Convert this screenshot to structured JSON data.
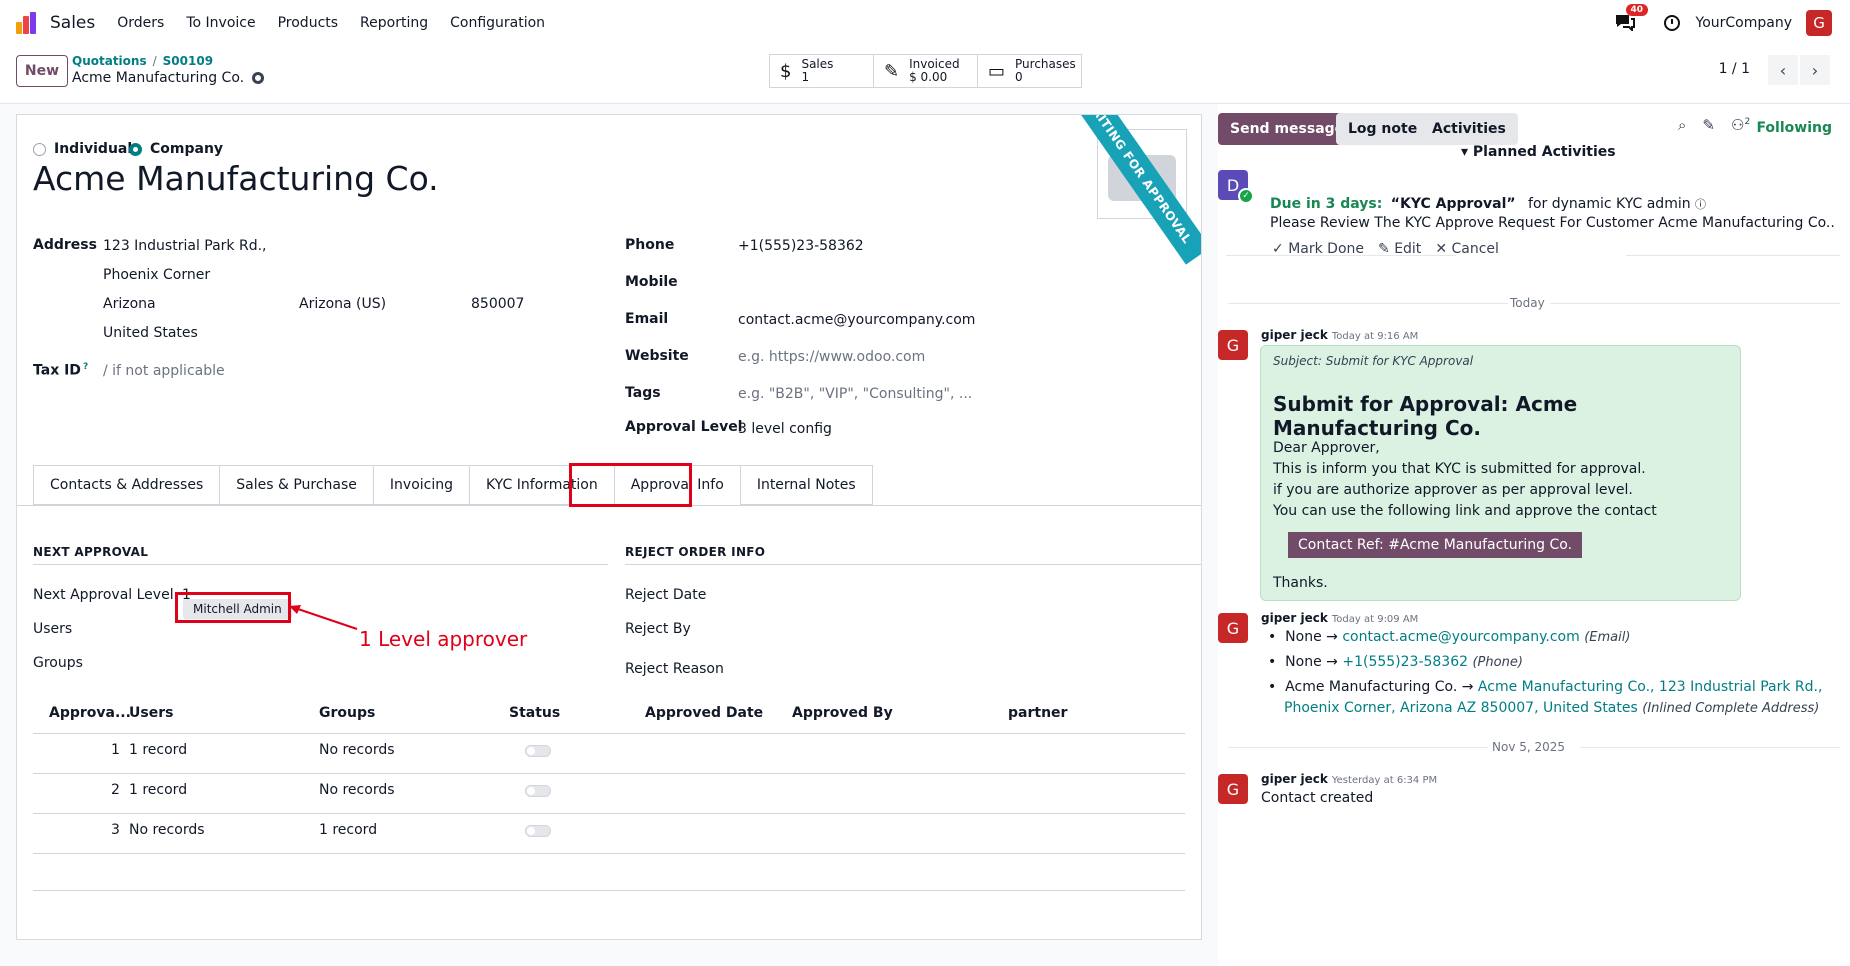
{
  "nav": {
    "app": "Sales",
    "menus": [
      "Orders",
      "To Invoice",
      "Products",
      "Reporting",
      "Configuration"
    ],
    "chat_badge": "40",
    "company": "YourCompany",
    "user_initial": "G"
  },
  "control": {
    "new": "New",
    "crumb1": "Quotations",
    "crumb2": "S00109",
    "record": "Acme Manufacturing Co.",
    "smart": [
      {
        "label": "Sales",
        "value": "1",
        "icon": "dollar-icon"
      },
      {
        "label": "Invoiced",
        "value": "$ 0.00",
        "icon": "edit-icon"
      },
      {
        "label": "Purchases",
        "value": "0",
        "icon": "card-icon"
      }
    ],
    "pager": "1 / 1"
  },
  "form": {
    "ribbon": "WAITING FOR APPROVAL",
    "radio_individual": "Individual",
    "radio_company": "Company",
    "name": "Acme Manufacturing Co.",
    "address_label": "Address",
    "street": "123 Industrial Park Rd.,",
    "street2": "Phoenix Corner",
    "city": "Arizona",
    "state": "Arizona (US)",
    "zip": "850007",
    "country": "United States",
    "taxid_label": "Tax ID",
    "taxid_sup": "?",
    "taxid_ph": "/ if not applicable",
    "phone_label": "Phone",
    "phone": "+1(555)23-58362",
    "mobile_label": "Mobile",
    "email_label": "Email",
    "email": "contact.acme@yourcompany.com",
    "website_label": "Website",
    "website_ph": "e.g. https://www.odoo.com",
    "tags_label": "Tags",
    "tags_ph": "e.g. \"B2B\", \"VIP\", \"Consulting\", ...",
    "approval_label": "Approval Level",
    "approval": "3 level config"
  },
  "tabs": [
    "Contacts & Addresses",
    "Sales & Purchase",
    "Invoicing",
    "KYC Information",
    "Approval Info",
    "Internal Notes"
  ],
  "approval": {
    "next_head": "NEXT APPROVAL",
    "reject_head": "REJECT ORDER INFO",
    "next_level_label": "Next Approval Level",
    "next_level": "1",
    "users_label": "Users",
    "user_tag": "Mitchell Admin",
    "groups_label": "Groups",
    "reject_date": "Reject Date",
    "reject_by": "Reject By",
    "reject_reason": "Reject Reason",
    "annotation": "1 Level approver"
  },
  "table": {
    "headers": [
      "Approva...",
      "Users",
      "Groups",
      "Status",
      "Approved Date",
      "Approved By",
      "partner"
    ],
    "rows": [
      {
        "level": "1",
        "users": "1 record",
        "groups": "No records"
      },
      {
        "level": "2",
        "users": "1 record",
        "groups": "No records"
      },
      {
        "level": "3",
        "users": "No records",
        "groups": "1 record"
      }
    ]
  },
  "chatter": {
    "send": "Send message",
    "log": "Log note",
    "activities": "Activities",
    "following": "Following",
    "followers": "2",
    "planned": "Planned Activities",
    "act_due": "Due in 3 days:",
    "act_title": "“KYC Approval”",
    "act_for": "for dynamic KYC admin",
    "act_desc": "Please Review The KYC Approve Request For Customer Acme Manufacturing Co..",
    "mark_done": "Mark Done",
    "edit": "Edit",
    "cancel": "Cancel",
    "act_avatar": "D",
    "today": "Today",
    "m1_author": "giper jeck",
    "m1_time": "Today at 9:16 AM",
    "m1_subject": "Subject: Submit for KYC Approval",
    "m1_title": "Submit for Approval: Acme Manufacturing Co.",
    "m1_l1": "Dear Approver,",
    "m1_l2": "This is inform you that KYC is submitted for approval.",
    "m1_l3": "if you are authorize approver as per approval level.",
    "m1_l4": "You can use the following link and approve the contact",
    "m1_btn": "Contact Ref: #Acme Manufacturing Co.",
    "m1_thanks": "Thanks.",
    "m2_author": "giper jeck",
    "m2_time": "Today at 9:09 AM",
    "t1_old": "None",
    "t1_new": "contact.acme@yourcompany.com",
    "t1_field": "(Email)",
    "t2_old": "None",
    "t2_new": "+1(555)23-58362",
    "t2_field": "(Phone)",
    "t3_old": "Acme Manufacturing Co.",
    "t3_new": "Acme Manufacturing Co., 123 Industrial Park Rd.,",
    "t3_new2": "Phoenix Corner, Arizona AZ 850007, United States",
    "t3_field": "(Inlined Complete Address)",
    "date2": "Nov 5, 2025",
    "m3_author": "giper jeck",
    "m3_time": "Yesterday at 6:34 PM",
    "m3_body": "Contact created"
  },
  "colors": {
    "brand": "#714b67",
    "teal": "#017e84",
    "ribbon": "#17a2b8",
    "annotation": "#e0001a"
  }
}
